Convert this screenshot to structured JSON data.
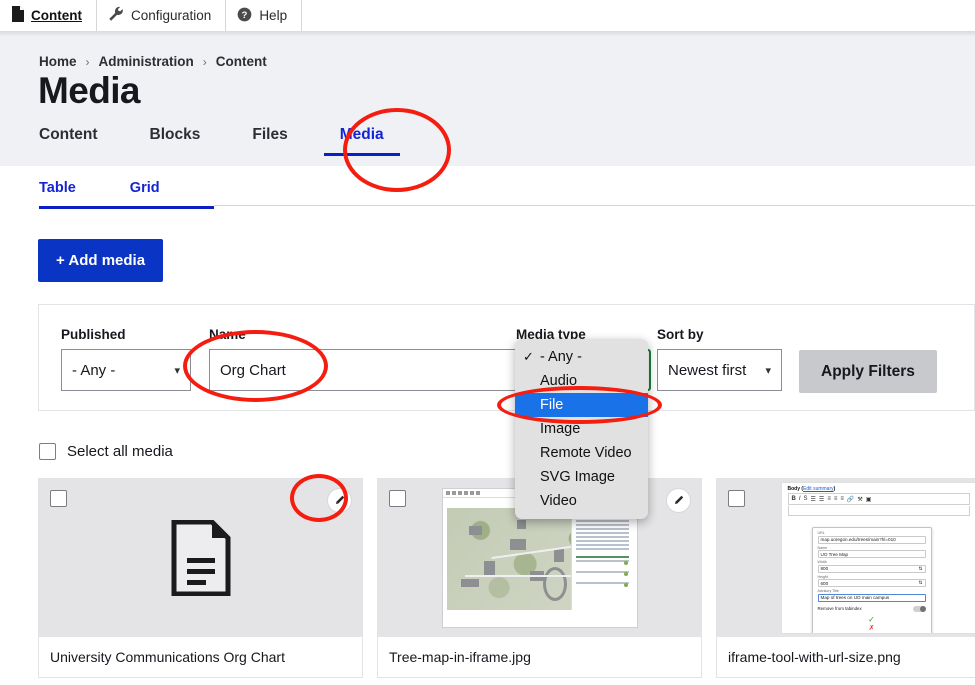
{
  "toolbar": {
    "items": [
      {
        "label": "Content",
        "icon": "page-icon",
        "active": true
      },
      {
        "label": "Configuration",
        "icon": "wrench-icon",
        "active": false
      },
      {
        "label": "Help",
        "icon": "question-circle-icon",
        "active": false
      }
    ]
  },
  "breadcrumb": {
    "items": [
      "Home",
      "Administration",
      "Content"
    ],
    "separator": "›"
  },
  "page": {
    "title": "Media"
  },
  "primary_tabs": [
    {
      "label": "Content",
      "active": false
    },
    {
      "label": "Blocks",
      "active": false
    },
    {
      "label": "Files",
      "active": false
    },
    {
      "label": "Media",
      "active": true
    }
  ],
  "secondary_tabs": [
    {
      "label": "Table",
      "active": true
    },
    {
      "label": "Grid",
      "active": false
    }
  ],
  "actions": {
    "add_media_label": "+ Add media"
  },
  "filters": {
    "published": {
      "label": "Published",
      "value": "- Any -"
    },
    "name": {
      "label": "Name",
      "value": "Org Chart",
      "placeholder": ""
    },
    "media_type": {
      "label": "Media type",
      "value": "- Any -",
      "open": true,
      "checkmark": "✓",
      "options": [
        {
          "label": "- Any -",
          "selected": true,
          "highlighted": false
        },
        {
          "label": "Audio",
          "selected": false,
          "highlighted": false
        },
        {
          "label": "File",
          "selected": false,
          "highlighted": true
        },
        {
          "label": "Image",
          "selected": false,
          "highlighted": false
        },
        {
          "label": "Remote Video",
          "selected": false,
          "highlighted": false
        },
        {
          "label": "SVG Image",
          "selected": false,
          "highlighted": false
        },
        {
          "label": "Video",
          "selected": false,
          "highlighted": false
        }
      ]
    },
    "sort_by": {
      "label": "Sort by",
      "value": "Newest first"
    },
    "apply_label": "Apply Filters"
  },
  "select_all": {
    "label": "Select all media",
    "checked": false
  },
  "media_cards": [
    {
      "title": "University Communications Org Chart",
      "thumb_type": "document-icon",
      "checked": false,
      "edit_label": "Edit"
    },
    {
      "title": "Tree-map-in-iframe.jpg",
      "thumb_type": "campus-map-image",
      "checked": false,
      "edit_label": "Edit"
    },
    {
      "title": "iframe-tool-with-url-size.png",
      "thumb_type": "iframe-form-image",
      "checked": false,
      "edit_label": "Edit"
    }
  ],
  "thumb_form": {
    "heading": "Body (",
    "heading_link": "Edit summary",
    "heading_end": ")",
    "fields": [
      {
        "label": "URL",
        "value": "map.uoregon.edu/trees/main?hl=010"
      },
      {
        "label": "Name",
        "value": "UO Tree Map"
      },
      {
        "label": "Width",
        "value": "800"
      },
      {
        "label": "Height",
        "value": "600"
      },
      {
        "label": "Advisory Title",
        "value": "Map of trees on UO main campus"
      }
    ],
    "toggle_label": "Remove from tabindex",
    "confirm": "✓",
    "cancel": "✗"
  },
  "thumb_map": {
    "legend_title": "CAMPUS TREE LEGEND",
    "panel_title": "Trees"
  },
  "colors": {
    "accent_blue": "#0a34c4",
    "link_blue": "#1424d4",
    "annotation_red": "#f41d10",
    "highlight_blue": "#1a72e8",
    "focus_green": "#1a7f3c",
    "header_bg": "#f0f1f5",
    "apply_gray": "#c8c9cd"
  }
}
